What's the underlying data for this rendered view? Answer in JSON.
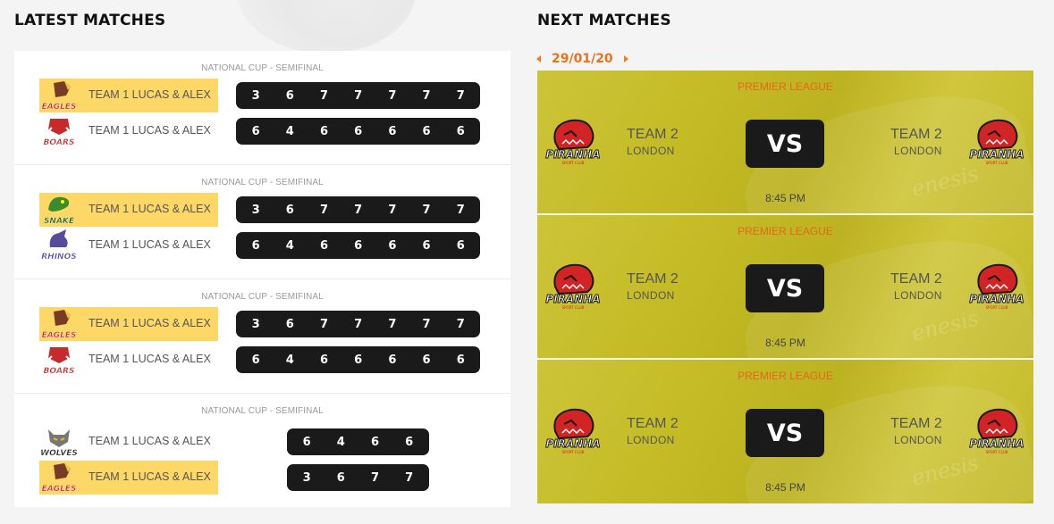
{
  "latest": {
    "title": "LATEST MATCHES",
    "matches": [
      {
        "competition": "NATIONAL CUP - SEMIFINAL",
        "teams": [
          {
            "name": "TEAM 1 LUCAS & ALEX",
            "logo": "eagles-logo",
            "logo_text": "EAGLES",
            "winner": true,
            "scores": [
              "3",
              "6",
              "7",
              "7",
              "7",
              "7",
              "7"
            ]
          },
          {
            "name": "TEAM 1 LUCAS & ALEX",
            "logo": "boars-logo",
            "logo_text": "BOARS",
            "winner": false,
            "scores": [
              "6",
              "4",
              "6",
              "6",
              "6",
              "6",
              "6"
            ]
          }
        ]
      },
      {
        "competition": "NATIONAL CUP - SEMIFINAL",
        "teams": [
          {
            "name": "TEAM 1 LUCAS & ALEX",
            "logo": "snake-logo",
            "logo_text": "SNAKE",
            "winner": true,
            "scores": [
              "3",
              "6",
              "7",
              "7",
              "7",
              "7",
              "7"
            ]
          },
          {
            "name": "TEAM 1 LUCAS & ALEX",
            "logo": "rhinos-logo",
            "logo_text": "RHINOS",
            "winner": false,
            "scores": [
              "6",
              "4",
              "6",
              "6",
              "6",
              "6",
              "6"
            ]
          }
        ]
      },
      {
        "competition": "NATIONAL CUP - SEMIFINAL",
        "teams": [
          {
            "name": "TEAM 1 LUCAS & ALEX",
            "logo": "eagles-logo",
            "logo_text": "EAGLES",
            "winner": true,
            "scores": [
              "3",
              "6",
              "7",
              "7",
              "7",
              "7",
              "7"
            ]
          },
          {
            "name": "TEAM 1 LUCAS & ALEX",
            "logo": "boars-logo",
            "logo_text": "BOARS",
            "winner": false,
            "scores": [
              "6",
              "4",
              "6",
              "6",
              "6",
              "6",
              "6"
            ]
          }
        ]
      },
      {
        "competition": "NATIONAL CUP - SEMIFINAL",
        "teams": [
          {
            "name": "TEAM 1 LUCAS & ALEX",
            "logo": "wolves-logo",
            "logo_text": "WOLVES",
            "winner": false,
            "scores": [
              "6",
              "4",
              "6",
              "6"
            ]
          },
          {
            "name": "TEAM 1 LUCAS & ALEX",
            "logo": "eagles-logo",
            "logo_text": "EAGLES",
            "winner": true,
            "scores": [
              "3",
              "6",
              "7",
              "7"
            ]
          }
        ]
      }
    ]
  },
  "next": {
    "title": "NEXT MATCHES",
    "date": "29/01/20",
    "fixtures": [
      {
        "league": "PREMIER LEAGUE",
        "home": {
          "name": "TEAM 2",
          "city": "LONDON",
          "logo_text": "PIRANHA"
        },
        "away": {
          "name": "TEAM 2",
          "city": "LONDON",
          "logo_text": "PIRANHA"
        },
        "vs": "VS",
        "time": "8:45 PM"
      },
      {
        "league": "PREMIER LEAGUE",
        "home": {
          "name": "TEAM 2",
          "city": "LONDON",
          "logo_text": "PIRANHA"
        },
        "away": {
          "name": "TEAM 2",
          "city": "LONDON",
          "logo_text": "PIRANHA"
        },
        "vs": "VS",
        "time": "8:45 PM"
      },
      {
        "league": "PREMIER LEAGUE",
        "home": {
          "name": "TEAM 2",
          "city": "LONDON",
          "logo_text": "PIRANHA"
        },
        "away": {
          "name": "TEAM 2",
          "city": "LONDON",
          "logo_text": "PIRANHA"
        },
        "vs": "VS",
        "time": "8:45 PM"
      }
    ],
    "watermark": "enesis"
  },
  "colors": {
    "winner_highlight": "#fdd867",
    "accent_orange": "#e8721a",
    "score_bg": "#1a1a1a",
    "fixture_bg": "#c8bf24"
  }
}
